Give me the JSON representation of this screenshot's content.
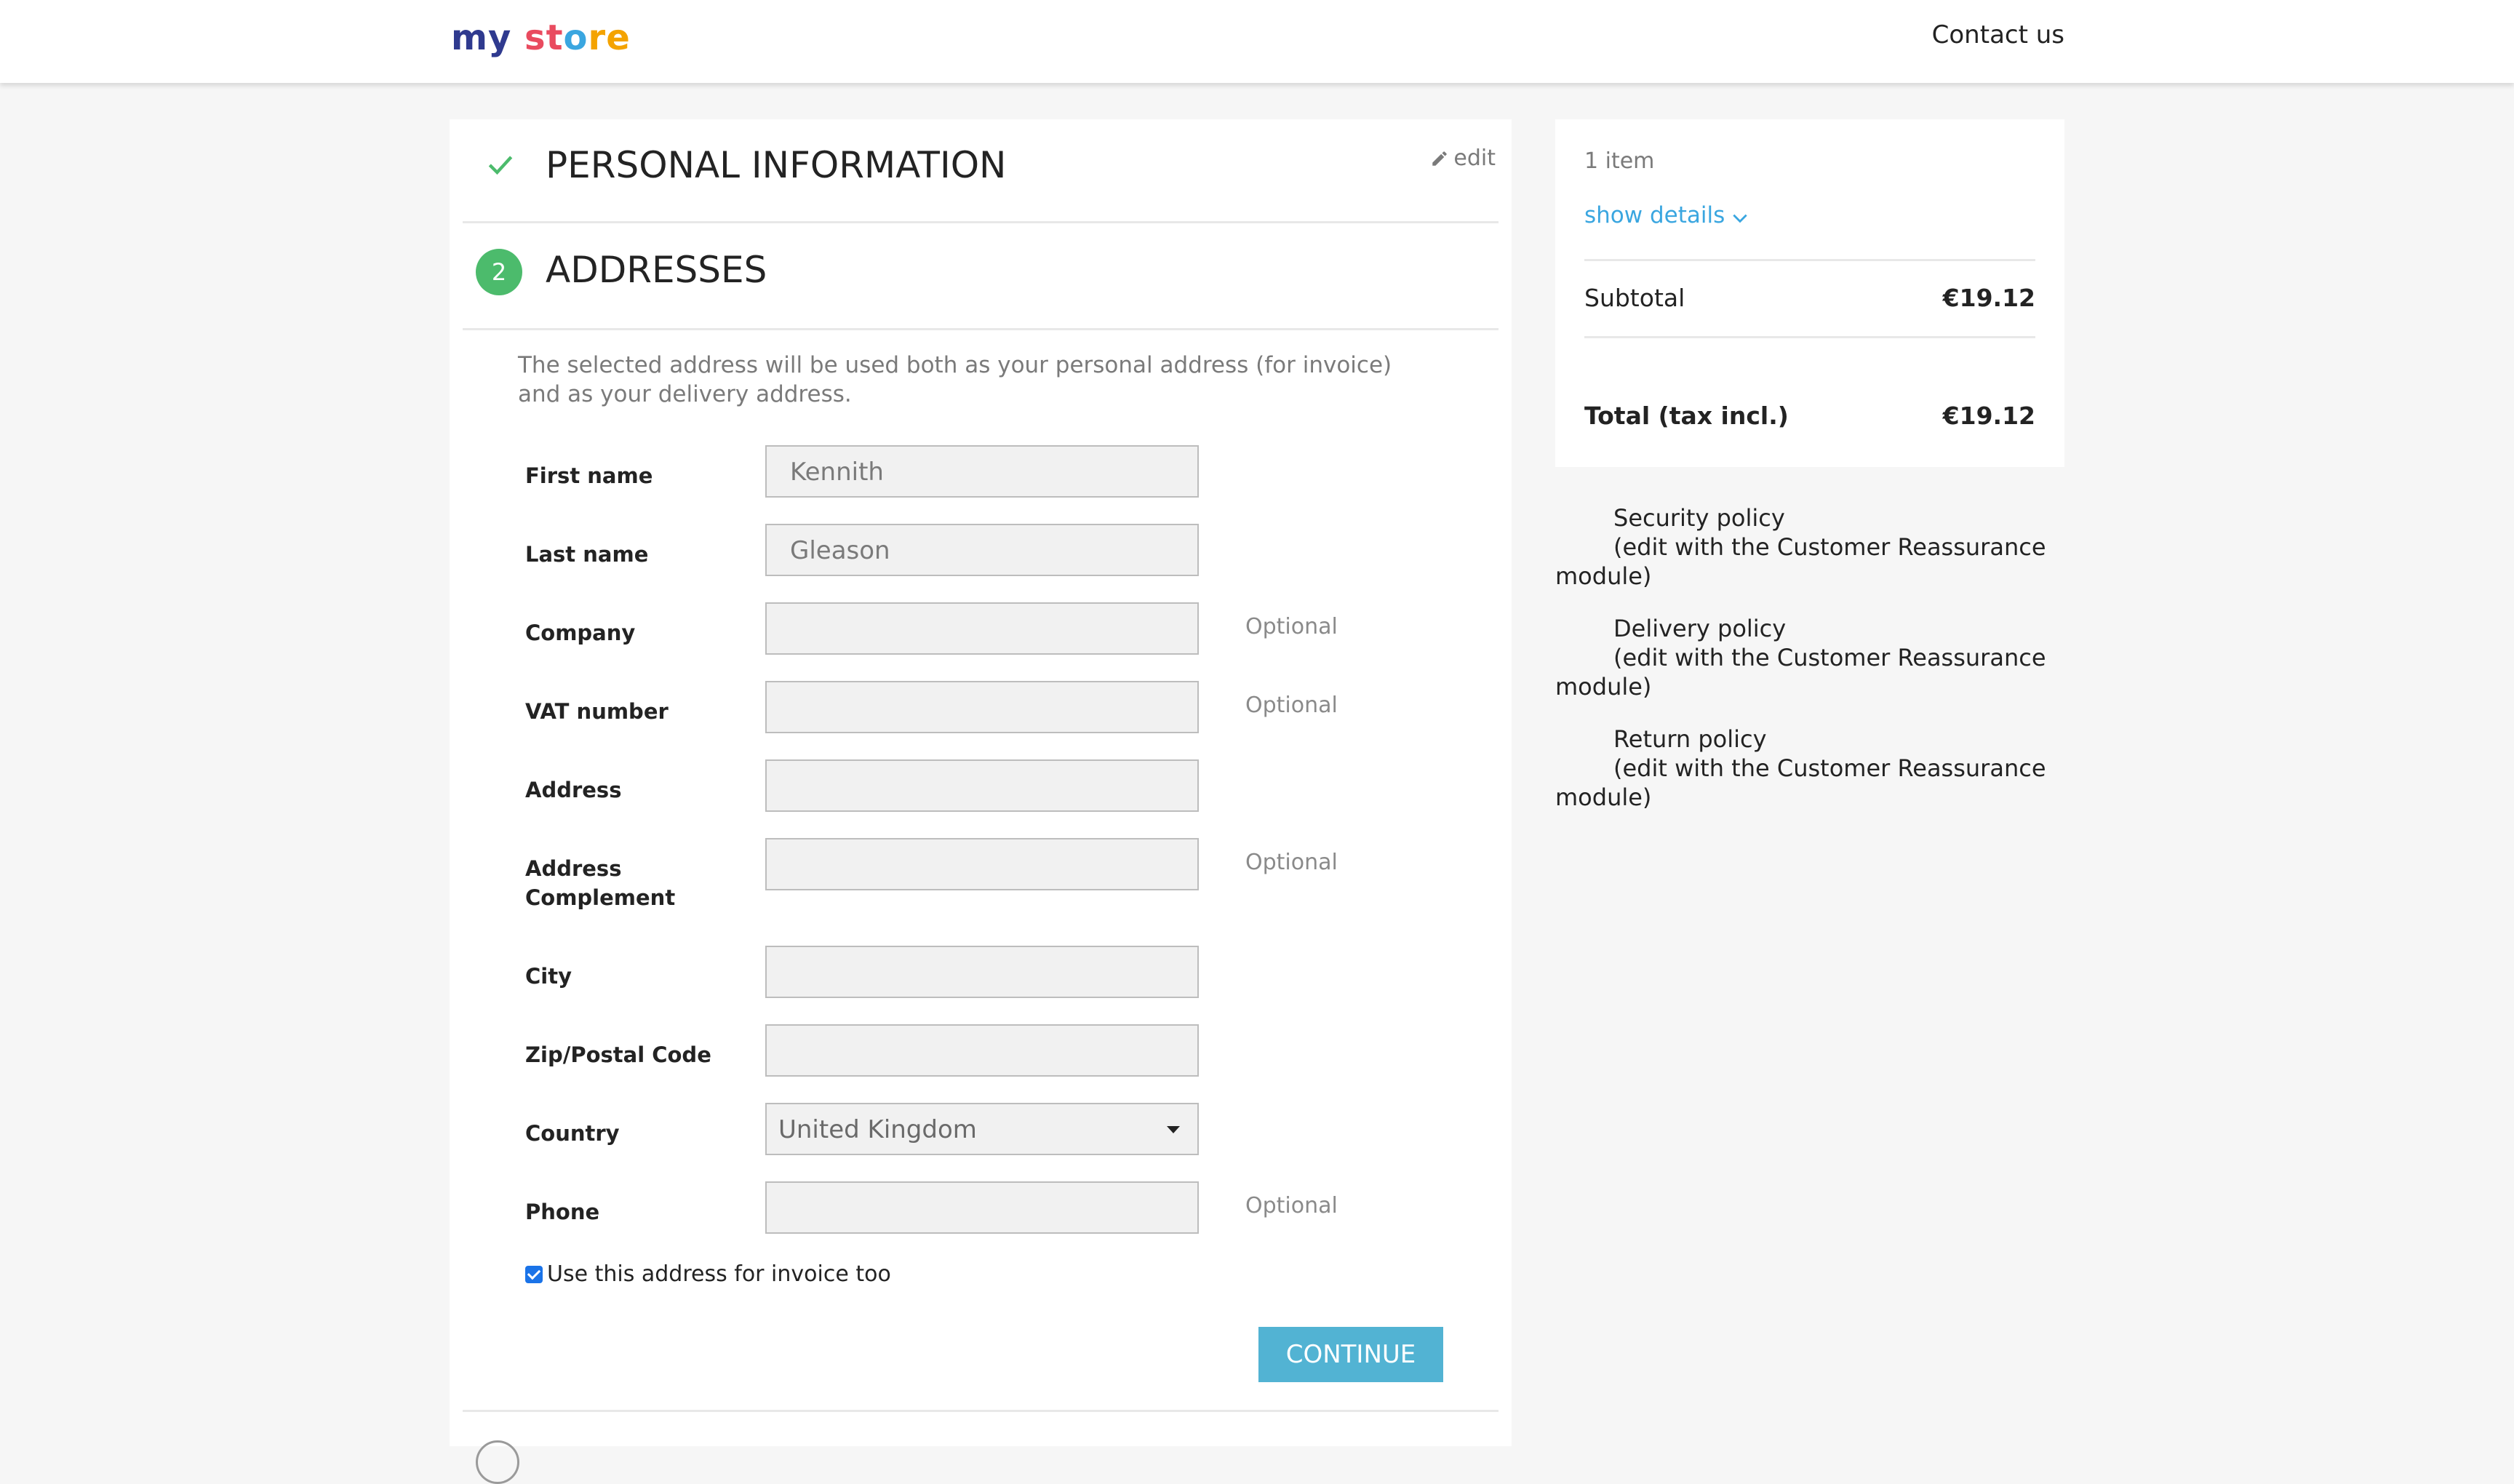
{
  "header": {
    "logo_parts": [
      "my",
      "st",
      "o",
      "re"
    ],
    "contact_label": "Contact us"
  },
  "checkout": {
    "step1": {
      "title": "PERSONAL INFORMATION",
      "edit_label": "edit"
    },
    "step2": {
      "number": "2",
      "title": "ADDRESSES",
      "intro": "The selected address will be used both as your personal address (for invoice) and as your delivery address."
    },
    "fields": [
      {
        "label": "First name",
        "value": "Kennith",
        "optional": ""
      },
      {
        "label": "Last name",
        "value": "Gleason",
        "optional": ""
      },
      {
        "label": "Company",
        "value": "",
        "optional": "Optional"
      },
      {
        "label": "VAT number",
        "value": "",
        "optional": "Optional"
      },
      {
        "label": "Address",
        "value": "",
        "optional": ""
      },
      {
        "label": "Address Complement",
        "value": "",
        "optional": "Optional"
      },
      {
        "label": "City",
        "value": "",
        "optional": ""
      },
      {
        "label": "Zip/Postal Code",
        "value": "",
        "optional": ""
      },
      {
        "label": "Country",
        "value": "United Kingdom",
        "optional": ""
      },
      {
        "label": "Phone",
        "value": "",
        "optional": "Optional"
      }
    ],
    "invoice_checkbox_label": "Use this address for invoice too",
    "invoice_checked": true,
    "continue_label": "CONTINUE"
  },
  "summary": {
    "items_count": "1 item",
    "show_details": "show details",
    "subtotal_label": "Subtotal",
    "subtotal_value": "€19.12",
    "total_label": "Total (tax incl.)",
    "total_value": "€19.12"
  },
  "reassurance": [
    {
      "title": "Security policy",
      "desc": "(edit with the Customer Reassurance module)"
    },
    {
      "title": "Delivery policy",
      "desc": "(edit with the Customer Reassurance module)"
    },
    {
      "title": "Return policy",
      "desc": "(edit with the Customer Reassurance module)"
    }
  ],
  "colors": {
    "accent": "#52b3d3",
    "step_done": "#4cbb6c",
    "link": "#3aa6e0",
    "background": "#f6f6f6"
  }
}
